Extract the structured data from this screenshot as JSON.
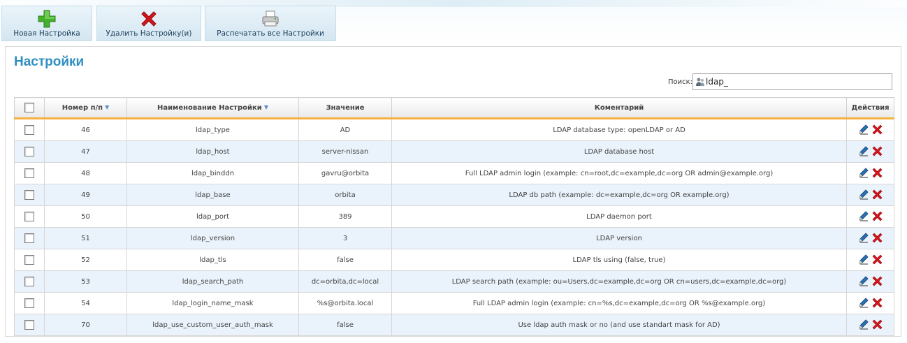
{
  "toolbar": {
    "new_label": "Новая Настройка",
    "delete_label": "Удалить Настройку(и)",
    "print_label": "Распечатать все Настройки"
  },
  "page_title": "Настройки",
  "search": {
    "label": "Поиск:",
    "value": "ldap_"
  },
  "table": {
    "headers": {
      "number": "Номер п/п",
      "name": "Наименование Настройки",
      "value": "Значение",
      "comment": "Коментарий",
      "actions": "Действия"
    },
    "rows": [
      {
        "num": "46",
        "name": "ldap_type",
        "value": "AD",
        "comment": "LDAP database type: openLDAP or AD"
      },
      {
        "num": "47",
        "name": "ldap_host",
        "value": "server-nissan",
        "comment": "LDAP database host"
      },
      {
        "num": "48",
        "name": "ldap_binddn",
        "value": "gavru@orbita",
        "comment": "Full LDAP admin login (example: cn=root,dc=example,dc=org OR admin@example.org)"
      },
      {
        "num": "49",
        "name": "ldap_base",
        "value": "orbita",
        "comment": "LDAP db path (example: dc=example,dc=org OR example.org)"
      },
      {
        "num": "50",
        "name": "ldap_port",
        "value": "389",
        "comment": "LDAP daemon port"
      },
      {
        "num": "51",
        "name": "ldap_version",
        "value": "3",
        "comment": "LDAP version"
      },
      {
        "num": "52",
        "name": "ldap_tls",
        "value": "false",
        "comment": "LDAP tls using (false, true)"
      },
      {
        "num": "53",
        "name": "ldap_search_path",
        "value": "dc=orbita,dc=local",
        "comment": "LDAP search path (example: ou=Users,dc=example,dc=org OR cn=users,dc=example,dc=org)"
      },
      {
        "num": "54",
        "name": "ldap_login_name_mask",
        "value": "%s@orbita.local",
        "comment": "Full LDAP admin login (example: cn=%s,dc=example,dc=org OR %s@example.org)"
      },
      {
        "num": "70",
        "name": "ldap_use_custom_user_auth_mask",
        "value": "false",
        "comment": "Use ldap auth mask or no (and use standart mask for AD)"
      }
    ]
  },
  "icons": {
    "new": "plus-icon",
    "delete": "red-x-icon",
    "print": "printer-icon",
    "search": "users-icon",
    "edit": "pencil-icon",
    "remove": "red-x-icon",
    "sort": "sort-down-icon"
  },
  "colors": {
    "title": "#2f8fc1",
    "header_underline": "#f5b23f",
    "row_alt": "#eaf3fb",
    "delete_red": "#d8141a",
    "add_green": "#3faa2a"
  }
}
